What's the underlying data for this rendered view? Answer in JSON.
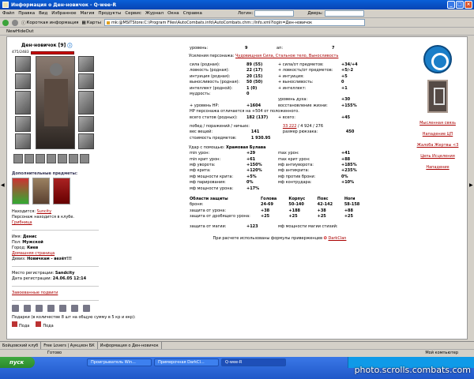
{
  "window": {
    "title": "Информация о Ден-новичок - Q-wee-R"
  },
  "menu": {
    "items": [
      "Файл",
      "Правка",
      "Вид",
      "Избранное",
      "Магия",
      "Продукты",
      "Сервис",
      "Журнал",
      "Окна",
      "Справка"
    ],
    "login_label": "Логин:",
    "door_label": "Дверь:"
  },
  "toolbar": {
    "short_info": "Короткая информация",
    "cards": "Карты",
    "address": "mk:@MSITStore:C:\\Program Files\\AutoCombats.info\\AutoCombats.chm::/Info.xml?login=Ден-новичок"
  },
  "bookmarks": {
    "item": "NewHideOut"
  },
  "character": {
    "name": "Ден-новичок",
    "level": "[9]",
    "hp": "475/2483",
    "additional_items_title": "Дополнительные предметы:",
    "location_label": "Находится:",
    "location": "Suncity",
    "in_club": "Персонаж находится в клубе.",
    "room": "Грибница",
    "name_label": "Имя:",
    "real_name": "Денис",
    "sex_label": "Пол:",
    "sex": "Мужской",
    "city_label": "Город:",
    "city": "Киев",
    "homepage": "Домашняя страница",
    "motto_label": "Девиз:",
    "motto": "Новичкам - везёт!!!",
    "reg_place_label": "Место регистрации:",
    "reg_place": "Sandcity",
    "reg_date_label": "Дата регистрации:",
    "reg_date": "24.06.05 12:14",
    "wins_link": "Завоеванные подвиги"
  },
  "gifts": {
    "text": "Подарки (в количестве 8 шт на общую сумму в 5 кр и екр):",
    "items": [
      "Пода",
      "Пода"
    ]
  },
  "stats": {
    "level_label": "уровень:",
    "level": "9",
    "exp_label": "ап:",
    "exp": "7",
    "boosts_label": "Усиления персонажа:",
    "boosts": "Чудовищная Сила, Стальное тело, Выносливость",
    "rows": [
      {
        "l": "сила (родная):",
        "v": "89 (55)",
        "l2": "+ сила/от предметов:",
        "v2": "+34/+4"
      },
      {
        "l": "ловкость (родная):",
        "v": "22 (17)",
        "l2": "+ ловкость/от предметов:",
        "v2": "+5/-2"
      },
      {
        "l": "интуиция (родная):",
        "v": "20 (15)",
        "l2": "+ интуиция:",
        "v2": "+5"
      },
      {
        "l": "выносливость (родная):",
        "v": "50 (50)",
        "l2": "+ выносливость:",
        "v2": "0"
      },
      {
        "l": "интеллект (родной):",
        "v": "1 (0)",
        "l2": "+ интеллект:",
        "v2": "+1"
      },
      {
        "l": "мудрость:",
        "v": "0",
        "l2": "",
        "v2": ""
      },
      {
        "l": "",
        "v": "",
        "l2": "уровень духа:",
        "v2": "+30"
      },
      {
        "l": "+ уровень HP:",
        "v": "+1604",
        "l2": "восстановление жизни:",
        "v2": "+155%"
      },
      {
        "l": "HP персонажа отличается на +504 от положенного.",
        "v": "",
        "l2": "",
        "v2": ""
      },
      {
        "l": "всего статов (родных):",
        "v": "182 (137)",
        "l2": "+ всего:",
        "v2": "+45"
      }
    ],
    "wins_label": "побед / поражений / ничьих:",
    "wins": "33 222",
    "wins_rest": "/ 4 924 / 276",
    "items_label": "вес вещей:",
    "items": "141",
    "resize_label": "размер рюкзака:",
    "resize": "450",
    "cost_label": "стоимость предметов:",
    "cost": "1 930.95",
    "attack_label": "Удар с помощью:",
    "weapon": "Храмовая Булава",
    "attack_rows": [
      {
        "l": "min урон:",
        "v": "+29",
        "l2": "max урон:",
        "v2": "+41"
      },
      {
        "l": "min крит урон:",
        "v": "+61",
        "l2": "max крит урон:",
        "v2": "+88"
      },
      {
        "l": "мф уворота:",
        "v": "+150%",
        "l2": "мф антиуворота:",
        "v2": "+185%"
      },
      {
        "l": "мф крита:",
        "v": "+120%",
        "l2": "мф антикрита:",
        "v2": "+235%"
      },
      {
        "l": "мф мощности крита:",
        "v": "+5%",
        "l2": "мф против брони:",
        "v2": "0%"
      },
      {
        "l": "мф парирования:",
        "v": "0%",
        "l2": "мф контрудара:",
        "v2": "+10%"
      },
      {
        "l": "мф мощности урона:",
        "v": "+17%",
        "l2": "",
        "v2": ""
      }
    ],
    "defense_header": [
      "Области защиты",
      "Голова",
      "Корпус",
      "Пояс",
      "Ноги"
    ],
    "defense_rows": [
      [
        "броня:",
        "24-69",
        "50-140",
        "42-142",
        "58-158"
      ],
      [
        "защита от урона:",
        "+38",
        "+188",
        "+38",
        "+88"
      ],
      [
        "защита от дробящего урона:",
        "+25",
        "+25",
        "+25",
        "+25"
      ]
    ],
    "magic_label": "защита от магии:",
    "magic": "+123",
    "magic_power_label": "мф мощности магии стихий:",
    "formula_text": "При расчете использованы формулы приверженцев",
    "clan": "DarkClan"
  },
  "right_links": [
    "Мысленная связь",
    "Нападение ЦП",
    "Жалоба Жертвы <3",
    "Цепь Исцеления",
    "Нападение"
  ],
  "status": {
    "tabs": [
      "Бойцовский клуб",
      "Free Lovers | Аукцион БК",
      "Информация о Ден-новичок"
    ],
    "ready": "Готово",
    "computer": "Мой компьютер"
  },
  "taskbar": {
    "start": "пуск",
    "tasks": [
      "Проигрыватель Win...",
      "Примерочная DarkCl...",
      "Q-wee-R"
    ]
  },
  "watermark": "photo.scrolls.combats.com"
}
